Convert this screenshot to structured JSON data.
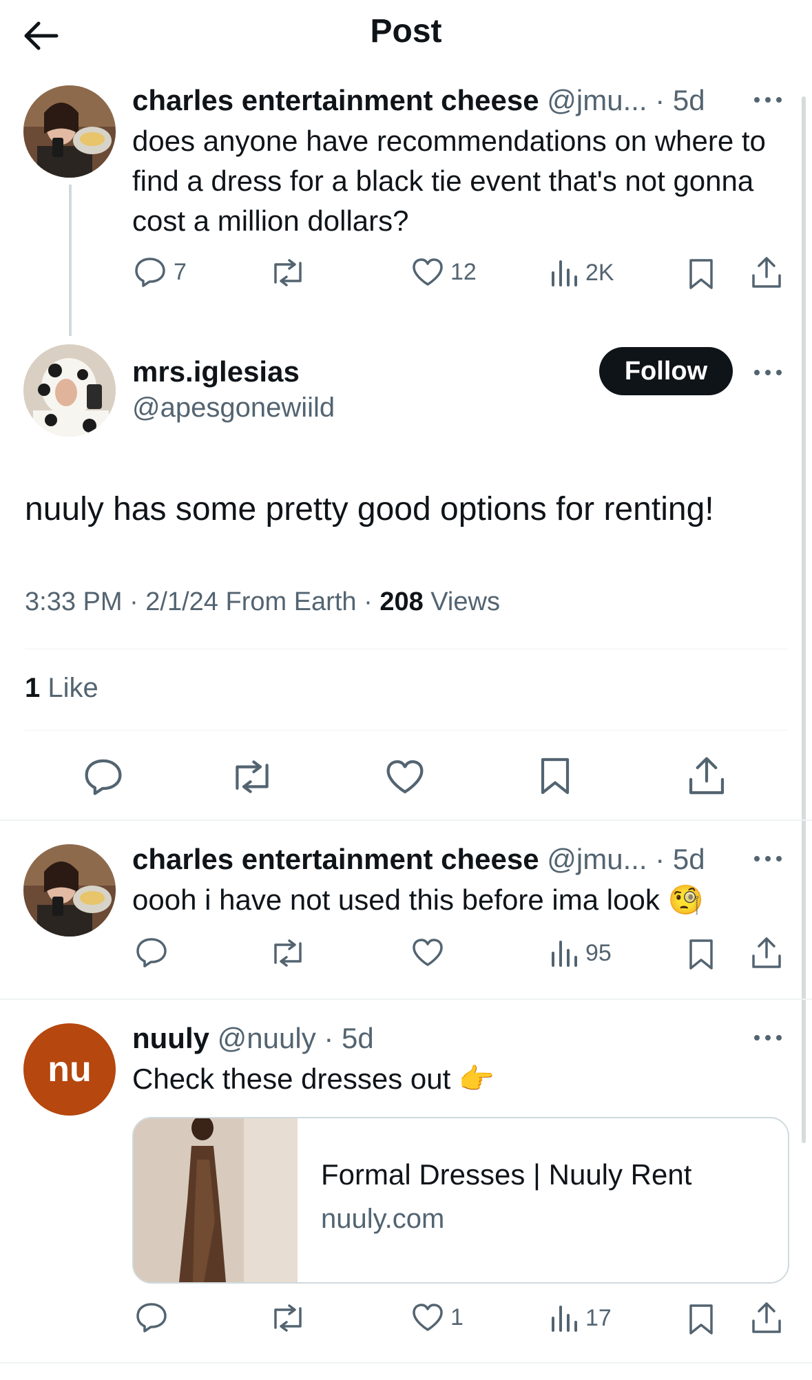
{
  "header": {
    "title": "Post"
  },
  "tweet1": {
    "name": "charles entertainment cheese",
    "handle": "@jmu...",
    "time": "· 5d",
    "text": "does anyone have recommendations on where to find a dress for a black tie event that's not gonna cost a million dollars?",
    "replies": "7",
    "likes": "12",
    "views": "2K"
  },
  "main_tweet": {
    "name": "mrs.iglesias",
    "handle": "@apesgonewiild",
    "follow_label": "Follow",
    "text": "nuuly has some pretty good options for renting!",
    "meta_prefix": "3:33 PM · 2/1/24 From Earth · ",
    "views_count": "208",
    "views_label": " Views",
    "likes_count": "1",
    "likes_label": " Like"
  },
  "reply1": {
    "name": "charles entertainment cheese",
    "handle": "@jmu...",
    "time": "· 5d",
    "text": "oooh i have not used this before ima look 🧐",
    "views": "95"
  },
  "reply2": {
    "avatar_text": "nu",
    "name": "nuuly",
    "handle": "@nuuly",
    "time": "· 5d",
    "text": "Check these dresses out 👉",
    "card_title": "Formal Dresses | Nuuly Rent",
    "card_domain": "nuuly.com",
    "likes": "1",
    "views": "17"
  },
  "colors": {
    "text": "#0f1419",
    "secondary": "#536471",
    "follow_bg": "#0f1419",
    "nuuly_avatar": "#b5470f"
  }
}
